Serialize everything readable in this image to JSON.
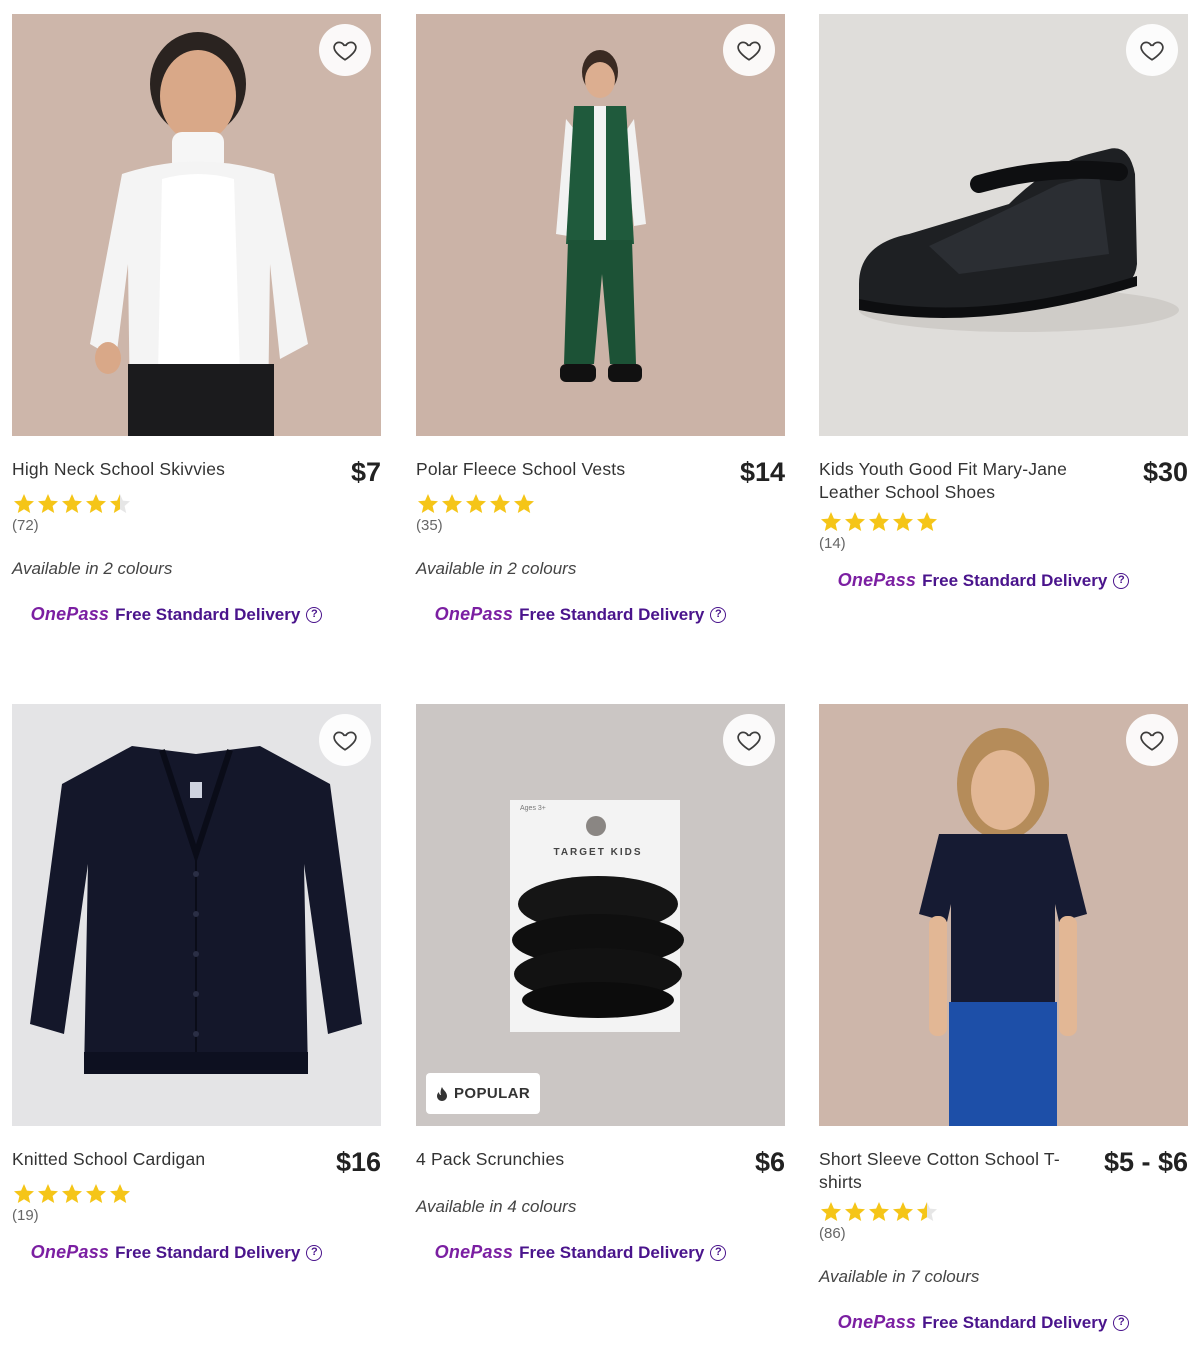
{
  "products": [
    {
      "title": "High Neck School Skivvies",
      "price": "$7",
      "rating": 4.5,
      "count": "(72)",
      "colours": "Available in 2 colours",
      "delivery_brand": "OnePass",
      "delivery_text": "Free Standard Delivery",
      "help": "?"
    },
    {
      "title": "Polar Fleece School Vests",
      "price": "$14",
      "rating": 5,
      "count": "(35)",
      "colours": "Available in 2 colours",
      "delivery_brand": "OnePass",
      "delivery_text": "Free Standard Delivery",
      "help": "?"
    },
    {
      "title": "Kids Youth Good Fit Mary-Jane Leather School Shoes",
      "price": "$30",
      "rating": 5,
      "count": "(14)",
      "delivery_brand": "OnePass",
      "delivery_text": "Free Standard Delivery",
      "help": "?"
    },
    {
      "title": "Knitted School Cardigan",
      "price": "$16",
      "rating": 5,
      "count": "(19)",
      "delivery_brand": "OnePass",
      "delivery_text": "Free Standard Delivery",
      "help": "?"
    },
    {
      "title": "4 Pack Scrunchies",
      "price": "$6",
      "badge": "POPULAR",
      "colours": "Available in 4 colours",
      "delivery_brand": "OnePass",
      "delivery_text": "Free Standard Delivery",
      "help": "?",
      "package_brand": "TARGET KIDS",
      "package_age": "Ages 3+"
    },
    {
      "title": "Short Sleeve Cotton School T-shirts",
      "price": "$5 - $6",
      "rating": 4.5,
      "count": "(86)",
      "colours": "Available in 7 colours",
      "delivery_brand": "OnePass",
      "delivery_text": "Free Standard Delivery",
      "help": "?"
    }
  ],
  "colors": {
    "star": "#f5c518",
    "onepass": "#7b1fa2",
    "delivery": "#4a148c"
  }
}
